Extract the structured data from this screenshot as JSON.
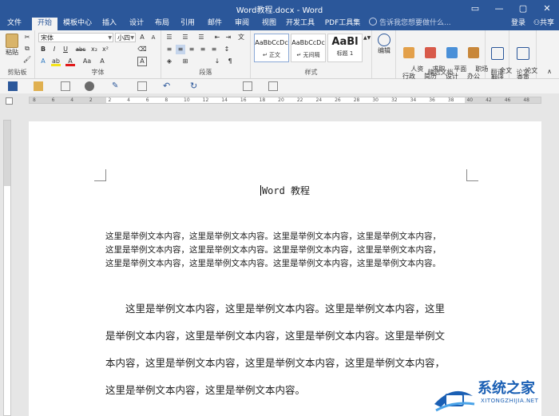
{
  "window": {
    "title": "Word教程.docx - Word"
  },
  "tabs": [
    "文件",
    "开始",
    "模板中心",
    "插入",
    "设计",
    "布局",
    "引用",
    "邮件",
    "审阅",
    "视图",
    "开发工具",
    "PDF工具集"
  ],
  "tell_me": "告诉我您想要做什么...",
  "account": {
    "login": "登录",
    "share": "共享"
  },
  "ribbon": {
    "clipboard": {
      "paste": "粘贴",
      "label": "剪贴板"
    },
    "font": {
      "name": "宋体",
      "size": "小四",
      "label": "字体",
      "bold": "B",
      "italic": "I",
      "underline": "U",
      "strike": "abc",
      "sub": "x₂",
      "sup": "x²",
      "grow": "A",
      "shrink": "A",
      "font_color": "A",
      "char_border": "A",
      "change_case": "Aa"
    },
    "paragraph": {
      "label": "段落"
    },
    "styles": {
      "label": "样式",
      "items": [
        {
          "sample": "AaBbCcDc",
          "name": "↵ 正文"
        },
        {
          "sample": "AaBbCcDc",
          "name": "↵ 无间隔"
        },
        {
          "sample": "AaBl",
          "name": "标题 1"
        }
      ]
    },
    "editing": {
      "label": "编辑"
    },
    "docs": {
      "label": "精选文档",
      "items": [
        "人资\n行政",
        "求职\n简历",
        "平面\n设计",
        "职场\n办公"
      ]
    },
    "translate": {
      "item": "全文\n翻译",
      "label": "翻译"
    },
    "paper": {
      "item": "论文\n查重",
      "label": "论文"
    }
  },
  "ruler_numbers": [
    "8",
    "6",
    "4",
    "2",
    "2",
    "4",
    "6",
    "8",
    "10",
    "12",
    "14",
    "16",
    "18",
    "20",
    "22",
    "24",
    "26",
    "28",
    "30",
    "32",
    "34",
    "36",
    "38",
    "40",
    "42",
    "46",
    "48"
  ],
  "document": {
    "title": "Word 教程",
    "small_lines": [
      "这里是举例文本内容，这里是举例文本内容。这里是举例文本内容，这里是举例文本内容，",
      "这里是举例文本内容，这里是举例文本内容。这里是举例文本内容，这里是举例文本内容，",
      "这里是举例文本内容，这里是举例文本内容。这里是举例文本内容，这里是举例文本内容。"
    ],
    "big_lines": [
      "　　这里是举例文本内容，这里是举例文本内容。这里是举例文本内容，这里",
      "是举例文本内容，这里是举例文本内容，这里是举例文本内容。这里是举例文",
      "本内容，这里是举例文本内容，这里是举例文本内容，这里是举例文本内容，",
      "这里是举例文本内容，这里是举例文本内容。"
    ]
  },
  "watermark": {
    "name": "系统之家",
    "url": "XITONGZHIJIA.NET"
  },
  "colors": {
    "accent": "#2b579a",
    "font_color": "#e11919",
    "highlight": "#f4e31a"
  }
}
